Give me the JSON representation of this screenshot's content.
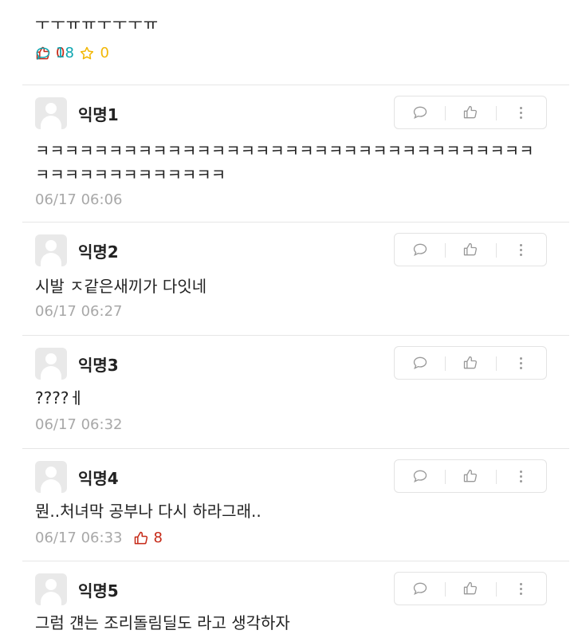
{
  "post": {
    "text_tail": "ㅜㅜㅠㅠㅜㅜㅜㅠ",
    "likes": "0",
    "comments": "18",
    "scraps": "0"
  },
  "comments": [
    {
      "nick": "익명1",
      "text": "ㅋㅋㅋㅋㅋㅋㅋㅋㅋㅋㅋㅋㅋㅋㅋㅋㅋㅋㅋㅋㅋㅋㅋㅋㅋㅋㅋㅋㅋㅋㅋㅋㅋㅋ",
      "text2": "ㅋㅋㅋㅋㅋㅋㅋㅋㅋㅋㅋㅋㅋ",
      "time": "06/17 06:06"
    },
    {
      "nick": "익명2",
      "text": "시발 ㅈ같은새끼가 다잇네",
      "time": "06/17 06:27"
    },
    {
      "nick": "익명3",
      "text": "????ㅔ",
      "time": "06/17 06:32"
    },
    {
      "nick": "익명4",
      "text": "뭔..처녀막 공부나 다시 하라그래..",
      "time": "06/17 06:33",
      "votes": "8"
    },
    {
      "nick": "익명5",
      "text": "그럼 걘는 조리돌림딜도 라고 생각하자"
    }
  ],
  "icons": {
    "like": "thumbs-up-icon",
    "comment": "speech-bubble-icon",
    "scrap": "star-icon",
    "more": "more-vertical-icon"
  },
  "colors": {
    "like": "#c62917",
    "comment": "#0ca5b0",
    "scrap": "#f2b705",
    "meta": "#a8a8a8"
  }
}
